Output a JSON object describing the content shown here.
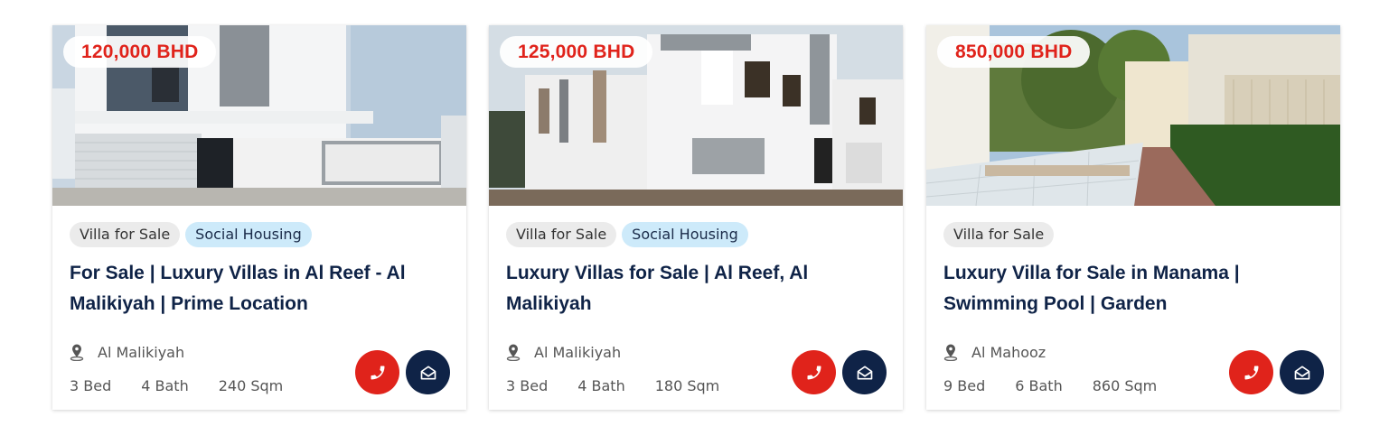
{
  "listings": [
    {
      "price": "120,000 BHD",
      "tags": [
        "Villa for Sale",
        "Social Housing"
      ],
      "title": "For Sale | Luxury Villas in Al Reef - Al Malikiyah | Prime Location",
      "location": "Al Malikiyah",
      "beds": "3 Bed",
      "baths": "4 Bath",
      "area": "240 Sqm"
    },
    {
      "price": "125,000 BHD",
      "tags": [
        "Villa for Sale",
        "Social Housing"
      ],
      "title": "Luxury Villas for Sale | Al Reef, Al Malikiyah",
      "location": "Al Malikiyah",
      "beds": "3 Bed",
      "baths": "4 Bath",
      "area": "180 Sqm"
    },
    {
      "price": "850,000 BHD",
      "tags": [
        "Villa for Sale"
      ],
      "title": "Luxury Villa for Sale in Manama | Swimming Pool | Garden",
      "location": "Al Mahooz",
      "beds": "9 Bed",
      "baths": "6 Bath",
      "area": "860 Sqm"
    }
  ],
  "icons": {
    "location": "map-pin-icon",
    "call": "phone-icon",
    "message": "envelope-open-icon"
  },
  "colors": {
    "price": "#e0231b",
    "call_button": "#e0231b",
    "message_button": "#0f2347",
    "title": "#0f2347",
    "tag_grey": "#ebebeb",
    "tag_blue": "#cdeafa"
  }
}
